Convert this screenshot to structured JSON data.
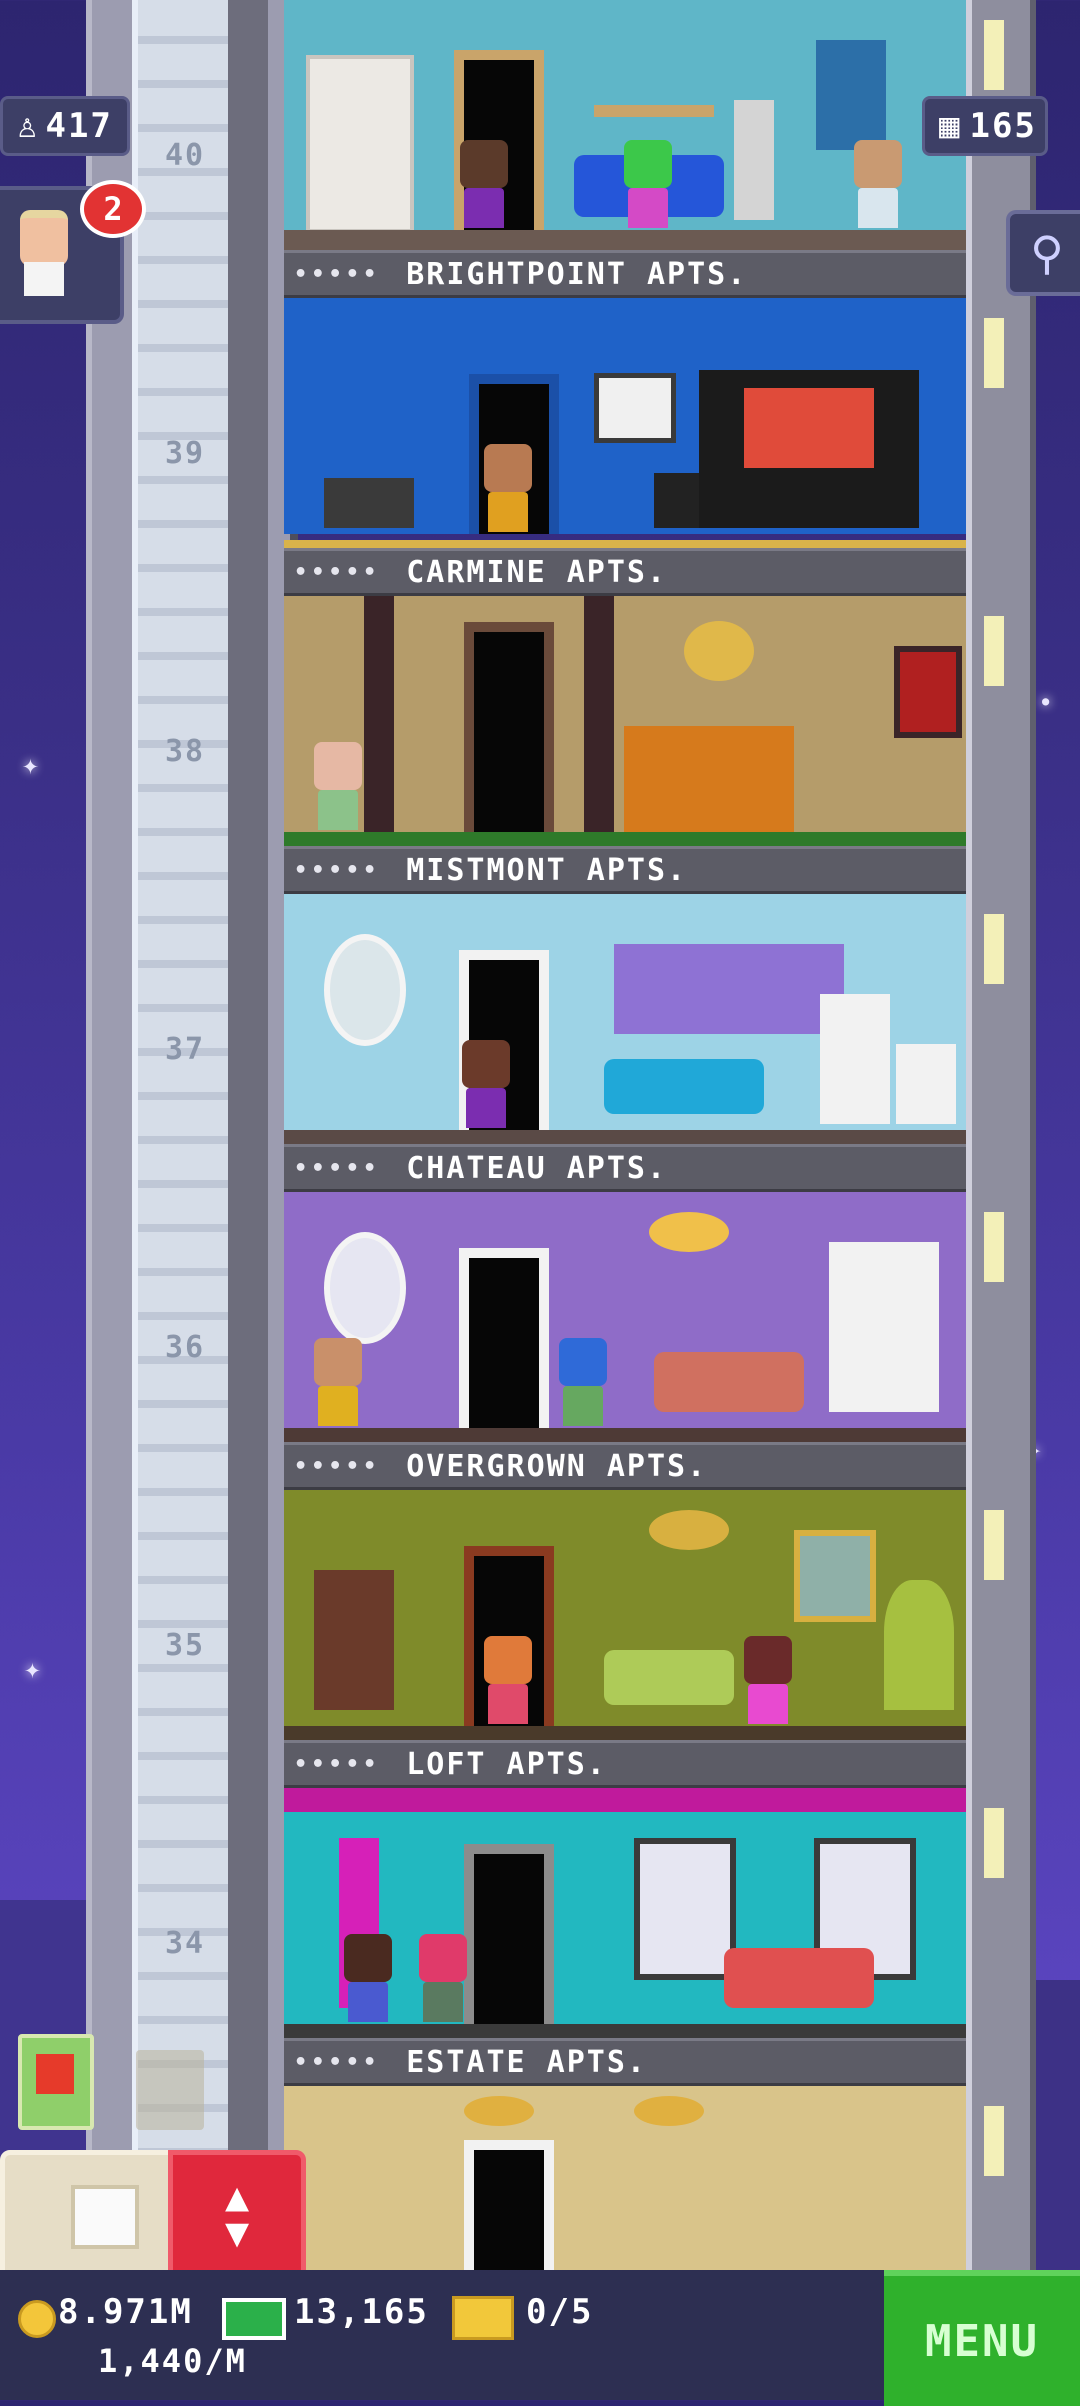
{
  "hud": {
    "population": "417",
    "floors": "165",
    "notification_count": "2"
  },
  "floors": [
    {
      "number": "40",
      "name": "BRIGHTPOINT APTS."
    },
    {
      "number": "39",
      "name": "CARMINE APTS."
    },
    {
      "number": "38",
      "name": "MISTMONT APTS."
    },
    {
      "number": "37",
      "name": "CHATEAU APTS."
    },
    {
      "number": "36",
      "name": "OVERGROWN APTS."
    },
    {
      "number": "35",
      "name": "LOFT APTS."
    },
    {
      "number": "34",
      "name": "ESTATE APTS."
    }
  ],
  "label_dots": "•••••",
  "bottom_bar": {
    "coins": "8.971M",
    "coin_rate": "1,440/M",
    "bux": "13,165",
    "tickets": "0/5",
    "menu_label": "MENU"
  },
  "icons": {
    "population": "person-icon",
    "floors": "building-icon",
    "search": "magnifier-icon",
    "coin": "coin-icon",
    "bux": "cash-icon",
    "ticket": "ticket-icon",
    "build": "box-icon",
    "elevator": "elevator-arrows-icon"
  },
  "colors": {
    "menu_green": "#2fb12c",
    "elevator_red": "#e0283c",
    "badge_red": "#e23333",
    "night_sky": "#3a2f86"
  }
}
